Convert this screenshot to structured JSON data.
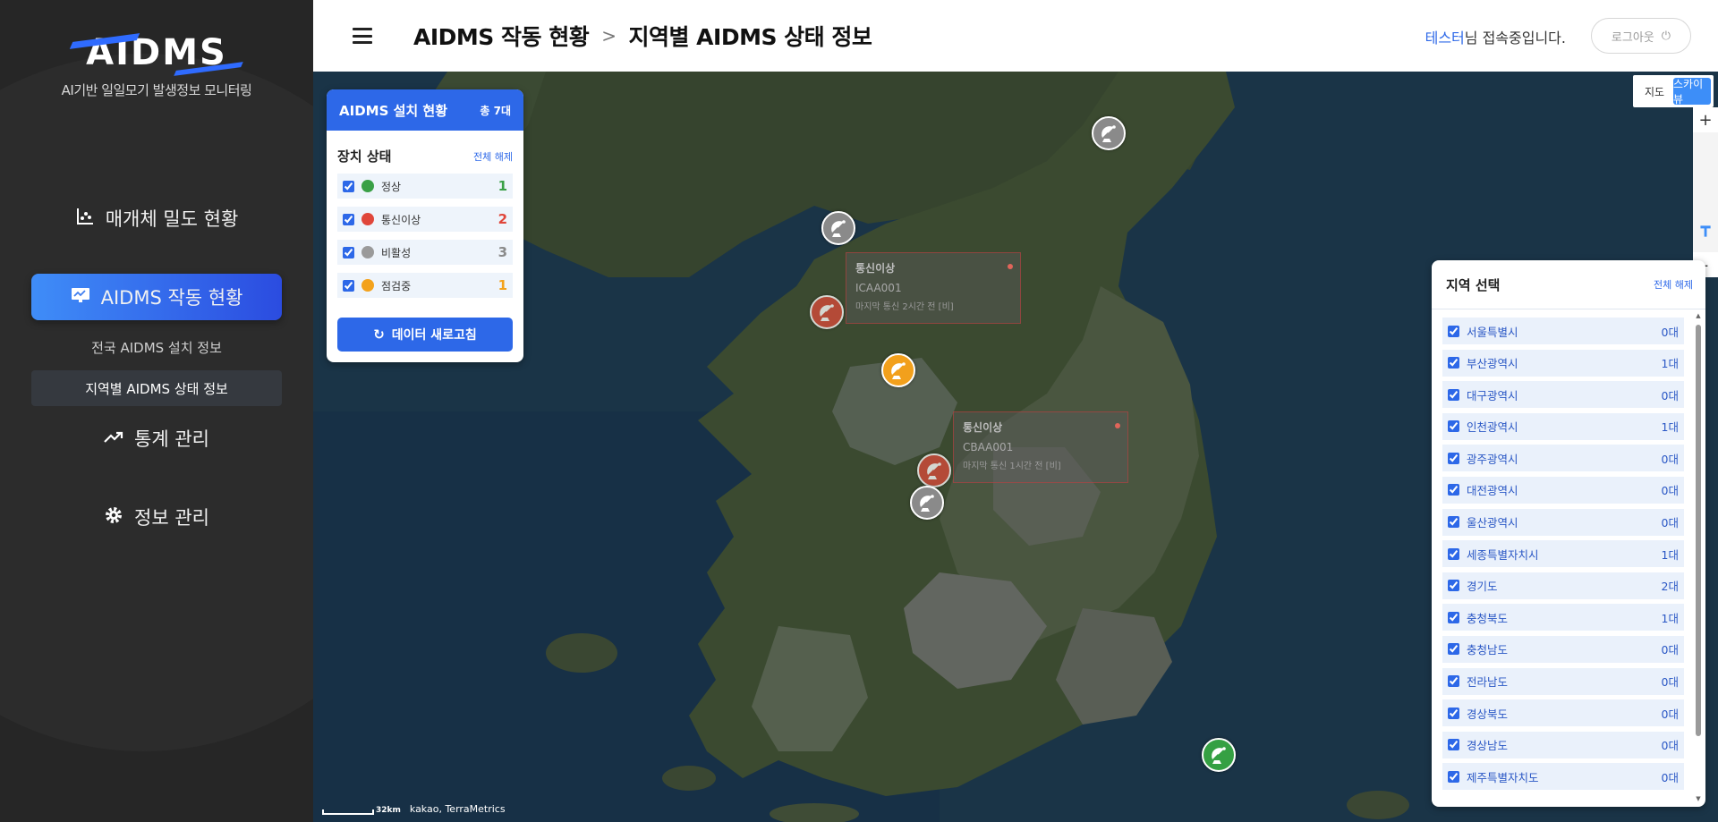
{
  "brand": {
    "logo_text": "AIDMS",
    "subtitle": "AI기반 일일모기 발생정보 모니터링"
  },
  "nav": {
    "items": [
      {
        "label": "매개체 밀도 현황",
        "icon": "chart-icon"
      },
      {
        "label": "AIDMS 작동 현황",
        "icon": "monitor-icon"
      },
      {
        "label": "통계 관리",
        "icon": "trend-icon"
      },
      {
        "label": "정보 관리",
        "icon": "gear-icon"
      }
    ],
    "sub_items": [
      {
        "label": "전국 AIDMS 설치 정보"
      },
      {
        "label": "지역별 AIDMS 상태 정보"
      }
    ]
  },
  "header": {
    "breadcrumb_parent": "AIDMS 작동 현황",
    "breadcrumb_sep": ">",
    "breadcrumb_current": "지역별 AIDMS 상태 정보",
    "user_name": "테스터",
    "user_suffix": "님 접속중입니다.",
    "logout_label": "로그아웃",
    "logout_icon": "⏻"
  },
  "status_panel": {
    "title": "AIDMS 설치 현황",
    "total": "총 7대",
    "section_title": "장치 상태",
    "clear_all": "전체 해제",
    "items": [
      {
        "label": "정상",
        "count": "1",
        "color": "#3aa046",
        "count_color": "#3aa046"
      },
      {
        "label": "통신이상",
        "count": "2",
        "color": "#e0463a",
        "count_color": "#e0463a"
      },
      {
        "label": "비활성",
        "count": "3",
        "color": "#9a9a9a",
        "count_color": "#8a8a8a"
      },
      {
        "label": "점검중",
        "count": "1",
        "color": "#f3a21c",
        "count_color": "#f3a21c"
      }
    ],
    "refresh_label": "데이터 새로고침"
  },
  "map_controls": {
    "map_label": "지도",
    "sky_label": "스카이뷰",
    "zoom_in": "+",
    "zoom_out": "-"
  },
  "region_panel": {
    "title": "지역 선택",
    "clear_all": "전체 해제",
    "regions": [
      {
        "name": "서울특별시",
        "count": "0대"
      },
      {
        "name": "부산광역시",
        "count": "1대"
      },
      {
        "name": "대구광역시",
        "count": "0대"
      },
      {
        "name": "인천광역시",
        "count": "1대"
      },
      {
        "name": "광주광역시",
        "count": "0대"
      },
      {
        "name": "대전광역시",
        "count": "0대"
      },
      {
        "name": "울산광역시",
        "count": "0대"
      },
      {
        "name": "세종특별자치시",
        "count": "1대"
      },
      {
        "name": "경기도",
        "count": "2대"
      },
      {
        "name": "충청북도",
        "count": "1대"
      },
      {
        "name": "충청남도",
        "count": "0대"
      },
      {
        "name": "전라남도",
        "count": "0대"
      },
      {
        "name": "경상북도",
        "count": "0대"
      },
      {
        "name": "경상남도",
        "count": "0대"
      },
      {
        "name": "제주특별자치도",
        "count": "0대"
      }
    ]
  },
  "tooltips": [
    {
      "status": "통신이상",
      "code": "ICAA001",
      "detail": "마지막 통신 2시간 전 [비]"
    },
    {
      "status": "통신이상",
      "code": "CBAA001",
      "detail": "마지막 통신 1시간 전 [비]"
    }
  ],
  "map_footer": {
    "scale": "32km",
    "copyright": "kakao, TerraMetrics"
  },
  "colors": {
    "accent": "#2d68e8",
    "sidebar_bg": "#262626",
    "active_nav": "#3f8df8"
  }
}
